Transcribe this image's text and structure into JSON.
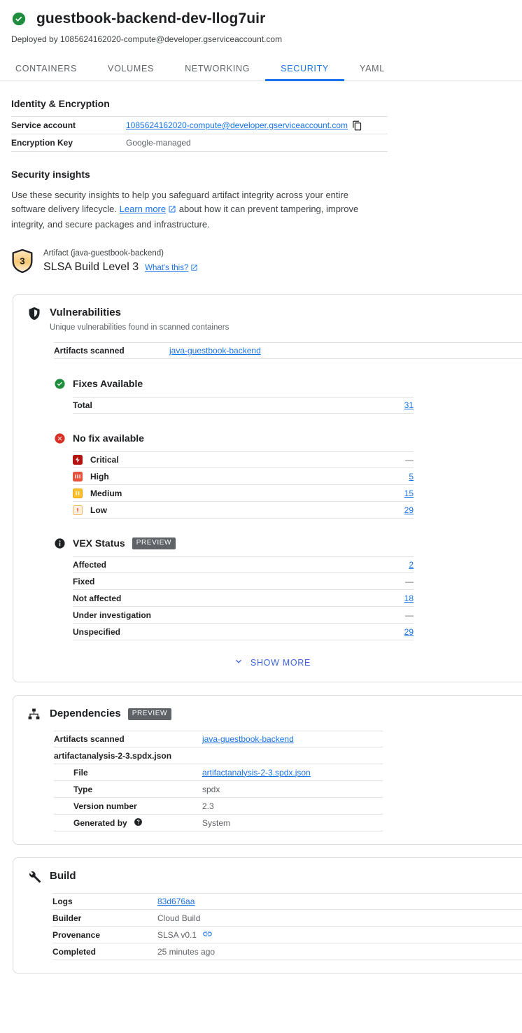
{
  "header": {
    "status_icon": "check-circle-icon",
    "title": "guestbook-backend-dev-llog7uir",
    "subtitle": "Deployed by 1085624162020-compute@developer.gserviceaccount.com"
  },
  "tabs": [
    {
      "label": "CONTAINERS",
      "active": false
    },
    {
      "label": "VOLUMES",
      "active": false
    },
    {
      "label": "NETWORKING",
      "active": false
    },
    {
      "label": "SECURITY",
      "active": true
    },
    {
      "label": "YAML",
      "active": false
    }
  ],
  "identity": {
    "heading": "Identity & Encryption",
    "rows": [
      {
        "key": "Service account",
        "value": "1085624162020-compute@developer.gserviceaccount.com",
        "link": true,
        "copy": true
      },
      {
        "key": "Encryption Key",
        "value": "Google-managed",
        "link": false,
        "copy": false
      }
    ],
    "copy_icon": "copy-icon"
  },
  "insights": {
    "heading": "Security insights",
    "text_before": "Use these security insights to help you safeguard artifact integrity across your entire software delivery lifecycle. ",
    "learn_more": "Learn more",
    "text_after": " about how it can prevent tampering, improve integrity, and secure packages and infrastructure.",
    "slsa": {
      "badge_level": "3",
      "artifact_line": "Artifact (java-guestbook-backend)",
      "level_text": "SLSA Build Level 3",
      "whats_this": "What's this?"
    }
  },
  "vulnerabilities": {
    "icon": "shield-icon",
    "title": "Vulnerabilities",
    "subtitle": "Unique vulnerabilities found in scanned containers",
    "artifacts_row": {
      "key": "Artifacts scanned",
      "value": "java-guestbook-backend"
    },
    "fixes_available": {
      "icon": "check-circle-icon",
      "title": "Fixes Available",
      "rows": [
        {
          "label": "Total",
          "value": "31",
          "link": true,
          "severity": null
        }
      ]
    },
    "no_fix": {
      "icon": "error-circle-icon",
      "title": "No fix available",
      "rows": [
        {
          "label": "Critical",
          "value": "—",
          "link": false,
          "severity": "critical"
        },
        {
          "label": "High",
          "value": "5",
          "link": true,
          "severity": "high"
        },
        {
          "label": "Medium",
          "value": "15",
          "link": true,
          "severity": "medium"
        },
        {
          "label": "Low",
          "value": "29",
          "link": true,
          "severity": "low"
        }
      ]
    },
    "vex": {
      "icon": "info-icon",
      "title": "VEX Status",
      "badge": "PREVIEW",
      "rows": [
        {
          "label": "Affected",
          "value": "2",
          "link": true,
          "severity": null
        },
        {
          "label": "Fixed",
          "value": "—",
          "link": false,
          "severity": null
        },
        {
          "label": "Not affected",
          "value": "18",
          "link": true,
          "severity": null
        },
        {
          "label": "Under investigation",
          "value": "—",
          "link": false,
          "severity": null
        },
        {
          "label": "Unspecified",
          "value": "29",
          "link": true,
          "severity": null
        }
      ]
    },
    "show_more": "SHOW MORE",
    "show_more_icon": "chevron-down-icon"
  },
  "dependencies": {
    "icon": "account-tree-icon",
    "title": "Dependencies",
    "badge": "PREVIEW",
    "rows": [
      {
        "key": "Artifacts scanned",
        "value": "java-guestbook-backend",
        "link": true,
        "indent": false,
        "help": false
      },
      {
        "key": "artifactanalysis-2-3.spdx.json",
        "value": "",
        "link": false,
        "indent": false,
        "help": false
      },
      {
        "key": "File",
        "value": "artifactanalysis-2-3.spdx.json",
        "link": true,
        "indent": true,
        "help": false
      },
      {
        "key": "Type",
        "value": "spdx",
        "link": false,
        "indent": true,
        "help": false
      },
      {
        "key": "Version number",
        "value": "2.3",
        "link": false,
        "indent": true,
        "help": false
      },
      {
        "key": "Generated by",
        "value": "System",
        "link": false,
        "indent": true,
        "help": true
      }
    ],
    "help_icon": "help-icon"
  },
  "build": {
    "icon": "wrench-icon",
    "title": "Build",
    "rows": [
      {
        "key": "Logs",
        "value": "83d676aa",
        "link": true,
        "chain": false
      },
      {
        "key": "Builder",
        "value": "Cloud Build",
        "link": false,
        "chain": false
      },
      {
        "key": "Provenance",
        "value": "SLSA v0.1",
        "link": false,
        "chain": true
      },
      {
        "key": "Completed",
        "value": "25 minutes ago",
        "link": false,
        "chain": false
      }
    ],
    "chain_icon": "link-chain-icon"
  },
  "colors": {
    "accent_blue": "#1a73e8",
    "success_green": "#1e8e3e",
    "error_red": "#d93025",
    "critical": "#b31412",
    "high": "#d93025",
    "medium": "#f9ab00",
    "low": "#fce8b2",
    "preview_badge": "#5f6368",
    "border": "#dadce0"
  }
}
